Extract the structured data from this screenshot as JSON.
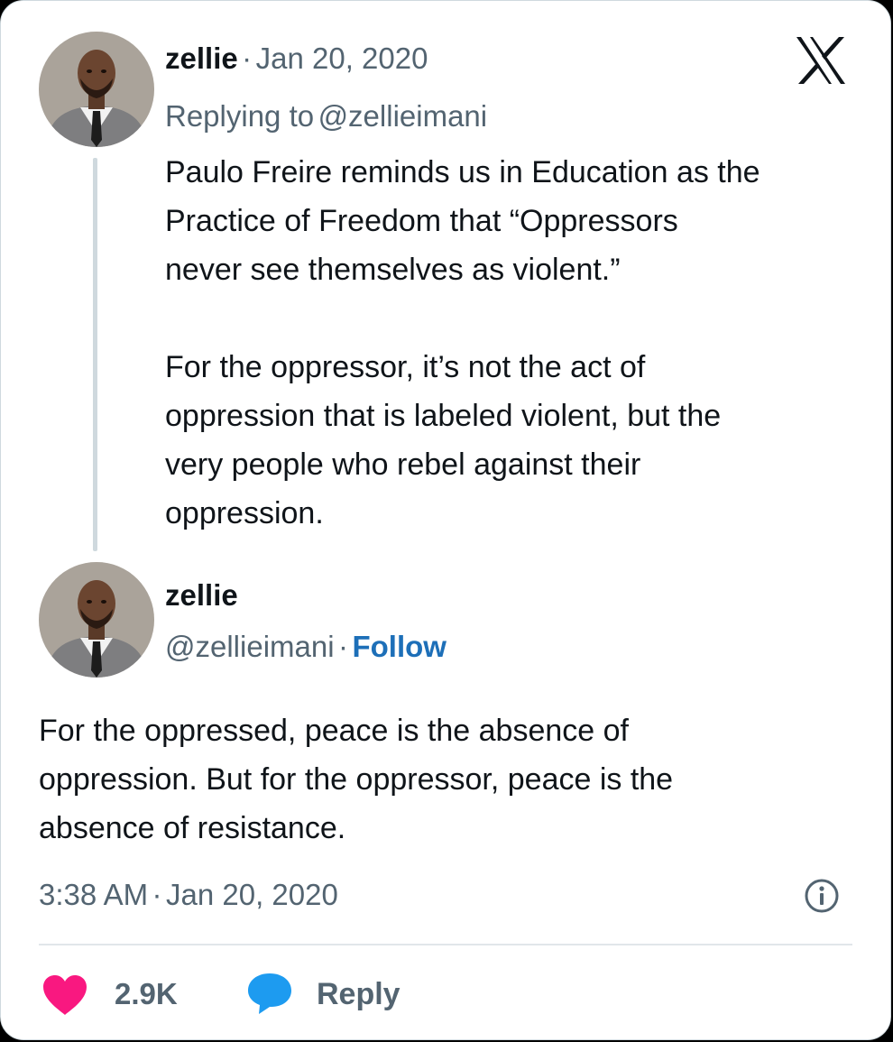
{
  "reply_tweet": {
    "author_name": "zellie",
    "separator": "·",
    "date": "Jan 20, 2020",
    "replying_prefix": "Replying to",
    "replying_handle": "@zellieimani",
    "text": "Paulo Freire reminds us in Education as the\nPractice of Freedom that “Oppressors\nnever see themselves as violent.”\n\nFor the oppressor, it’s not the act of\noppression that is labeled violent, but the\nvery people who rebel against their\noppression."
  },
  "main_tweet": {
    "author_name": "zellie",
    "handle": "@zellieimani",
    "separator": "·",
    "follow_label": "Follow",
    "text": "For the oppressed, peace is the absence of\noppression. But for the oppressor, peace is the\nabsence of resistance.",
    "time": "3:38 AM",
    "date": "Jan 20, 2020"
  },
  "actions": {
    "like_count": "2.9K",
    "reply_label": "Reply"
  },
  "icons": {
    "brand": "x-logo-icon",
    "info": "info-icon",
    "like": "heart-icon",
    "reply": "speech-bubble-icon"
  },
  "colors": {
    "text": "#0f1419",
    "muted": "#536471",
    "follow": "#1d6fb8",
    "heart": "#f91880",
    "reply_bubble": "#1d9bf0",
    "thread_line": "#cfd9de"
  }
}
